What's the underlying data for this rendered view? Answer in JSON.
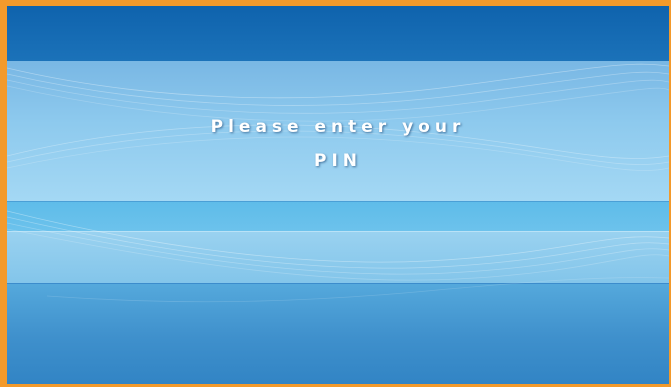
{
  "prompt": {
    "line1": "Please enter your",
    "line2": "PIN"
  },
  "colors": {
    "frame": "#f39a2b",
    "top_band": "#0f63ad",
    "light_band": "#a4d8f4",
    "bottom_band": "#2f82c3",
    "text": "#ffffff"
  }
}
